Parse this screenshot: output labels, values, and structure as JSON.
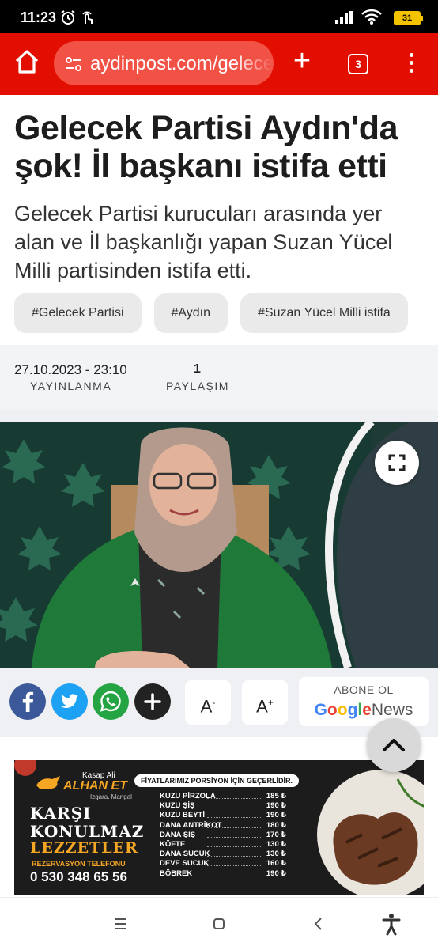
{
  "status_bar": {
    "time": "11:23",
    "battery": "31"
  },
  "browser": {
    "url": "aydinpost.com/gelecek",
    "tab_count": "3"
  },
  "article": {
    "title": "Gelecek Partisi Aydın'da şok! İl başkanı istifa etti",
    "summary": "Gelecek Partisi kurucuları arasında yer alan ve İl başkanlığı yapan Suzan Yücel Milli partisinden istifa etti.",
    "tags": [
      "#Gelecek Partisi",
      "#Aydın",
      "#Suzan Yücel Milli istifa"
    ],
    "date": "27.10.2023 - 23:10",
    "date_label": "YAYINLANMA",
    "share_count": "1",
    "share_label": "PAYLAŞIM"
  },
  "toolbar": {
    "font_decrease": "A",
    "font_increase": "A",
    "google_news_subscribe": "ABONE OL",
    "google_news_brand": [
      "G",
      "o",
      "o",
      "g",
      "l",
      "e",
      "News"
    ]
  },
  "ad": {
    "kasap": "Kasap Ali",
    "brand": "ALHAN ET",
    "brand_sub": "Izgara. Mangal",
    "headline_1": "KARŞI",
    "headline_2": "KONULMAZ",
    "headline_3": "LEZZETLER",
    "reservation_label": "REZERVASYON TELEFONU",
    "phone": "0 530 348 65 56",
    "notice": "FİYATLARIMIZ PORSİYON İÇİN GEÇERLİDİR.",
    "menu": [
      {
        "name": "KUZU PİRZOLA",
        "price": "185 ₺"
      },
      {
        "name": "KUZU ŞİŞ",
        "price": "190 ₺"
      },
      {
        "name": "KUZU BEYTİ",
        "price": "190 ₺"
      },
      {
        "name": "DANA ANTRİKOT",
        "price": "180 ₺"
      },
      {
        "name": "DANA ŞİŞ",
        "price": "170 ₺"
      },
      {
        "name": "KÖFTE",
        "price": "130 ₺"
      },
      {
        "name": "DANA SUCUK",
        "price": "130 ₺"
      },
      {
        "name": "DEVE SUCUK",
        "price": "160 ₺"
      },
      {
        "name": "BÖBREK",
        "price": "190 ₺"
      }
    ]
  },
  "colors": {
    "toolbar_red": "#e20f00",
    "facebook": "#3b5998",
    "twitter": "#1da1f2",
    "whatsapp": "#25a444",
    "party_green": "#2d8a4a"
  }
}
